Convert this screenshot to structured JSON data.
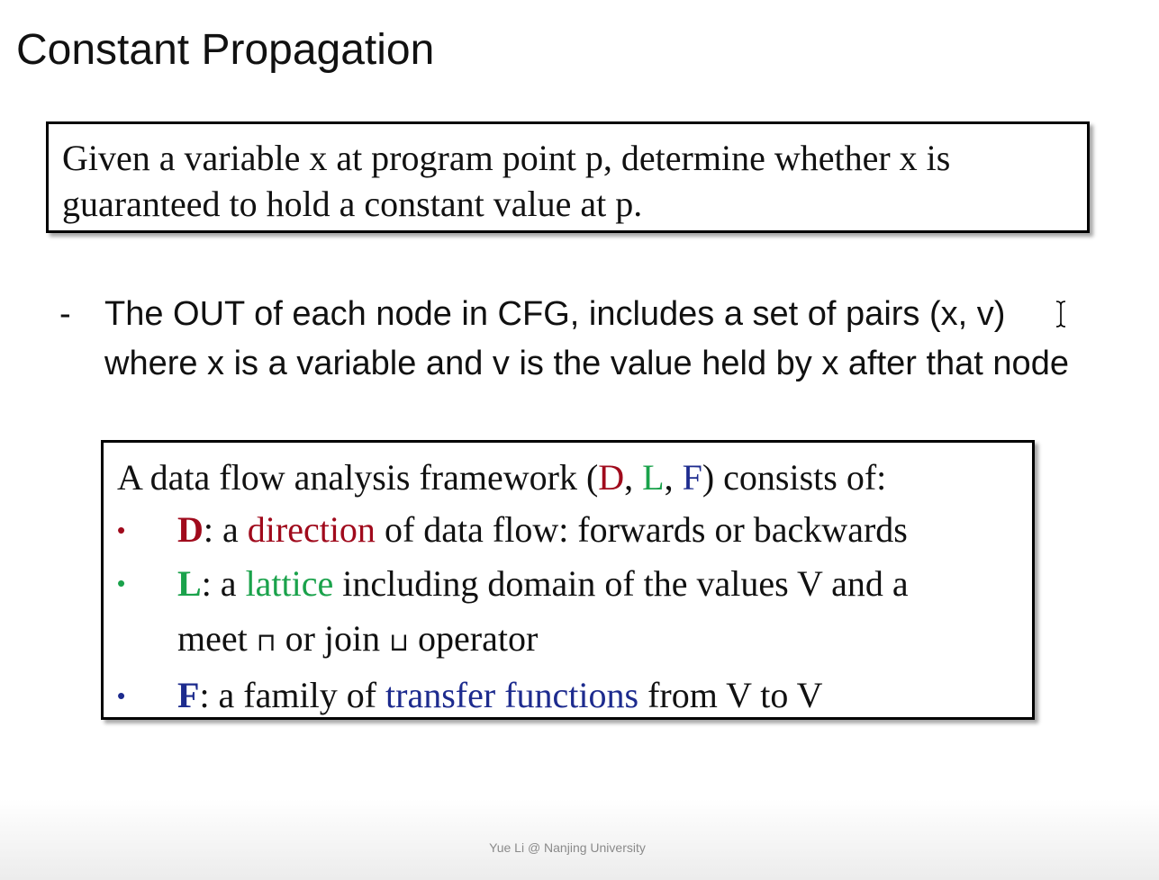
{
  "title": "Constant Propagation",
  "definition_box": {
    "line1": "Given a variable x at program point p, determine whether x is",
    "line2": "guaranteed to hold a constant value at p."
  },
  "bullet": {
    "marker": "-",
    "line1": "The OUT of each node in CFG, includes a set of pairs (x, v)",
    "line2": "where x is a variable and v is the value held by x after that node"
  },
  "framework_box": {
    "intro_prefix": "A data flow analysis framework (",
    "intro_d": "D",
    "intro_sep1": ", ",
    "intro_l": "L",
    "intro_sep2": ", ",
    "intro_f": "F",
    "intro_suffix": ") consists of:",
    "bullet_marker": "•",
    "items": [
      {
        "key": "D",
        "pre": ": a ",
        "highlight": "direction",
        "rest": " of data flow: forwards or backwards"
      },
      {
        "key": "L",
        "pre": ": a ",
        "highlight": "lattice",
        "rest": " including domain of the values V and a",
        "line2_a": "meet ",
        "meet_symbol": "⊓",
        "line2_b": " or join ",
        "join_symbol": "⊔",
        "line2_c": " operator"
      },
      {
        "key": "F",
        "pre": ": a family of ",
        "highlight": "transfer functions",
        "rest": " from V to V"
      }
    ]
  },
  "footer": "Yue Li @ Nanjing University",
  "colors": {
    "direction": "#a00a1c",
    "lattice": "#1aa24b",
    "transfer": "#1d2b8e"
  },
  "icons": {
    "cursor": "text-cursor-icon"
  }
}
